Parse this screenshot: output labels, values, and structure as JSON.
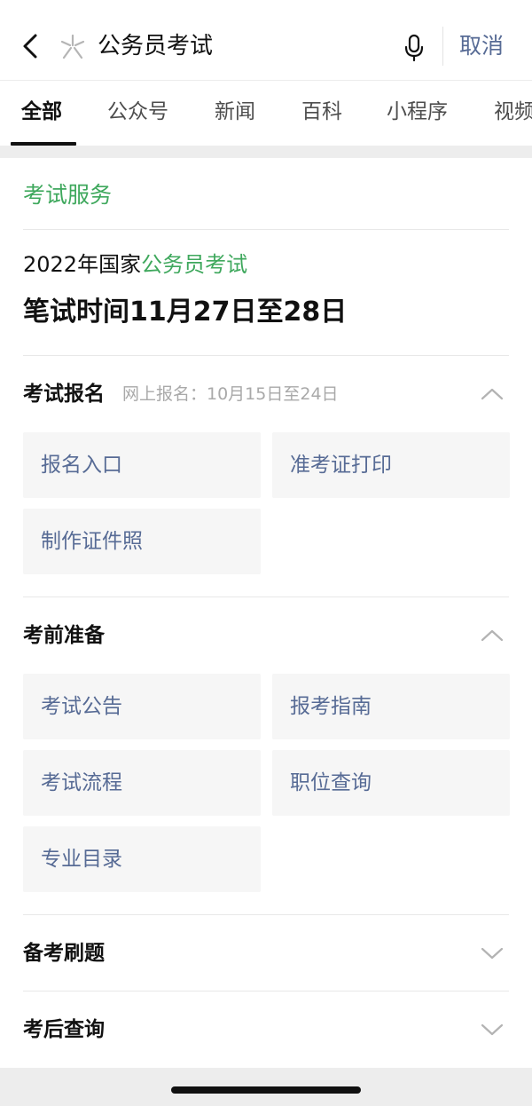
{
  "header": {
    "query": "公务员考试",
    "cancel_label": "取消",
    "icons": {
      "back": "chevron-left-icon",
      "search_type": "sparkle-icon",
      "voice": "microphone-icon"
    }
  },
  "tabs": [
    {
      "label": "全部",
      "active": true
    },
    {
      "label": "公众号",
      "active": false
    },
    {
      "label": "新闻",
      "active": false
    },
    {
      "label": "百科",
      "active": false
    },
    {
      "label": "小程序",
      "active": false
    },
    {
      "label": "视频",
      "active": false
    }
  ],
  "card": {
    "service_title": "考试服务",
    "exam": {
      "subtitle_prefix": "2022年国家",
      "subtitle_highlight": "公务员考试",
      "headline": "笔试时间11月27日至28日"
    },
    "sections": [
      {
        "title": "考试报名",
        "note": "网上报名：10月15日至24日",
        "expanded": true,
        "items": [
          "报名入口",
          "准考证打印",
          "制作证件照"
        ]
      },
      {
        "title": "考前准备",
        "expanded": true,
        "items": [
          "考试公告",
          "报考指南",
          "考试流程",
          "职位查询",
          "专业目录"
        ]
      },
      {
        "title": "备考刷题",
        "expanded": false
      },
      {
        "title": "考后查询",
        "expanded": false
      }
    ]
  },
  "colors": {
    "accent_green": "#3fa85d",
    "link_blue": "#576b95",
    "muted_gray": "#a9a9a9",
    "tile_bg": "#f6f6f6",
    "separator": "#ededed"
  }
}
